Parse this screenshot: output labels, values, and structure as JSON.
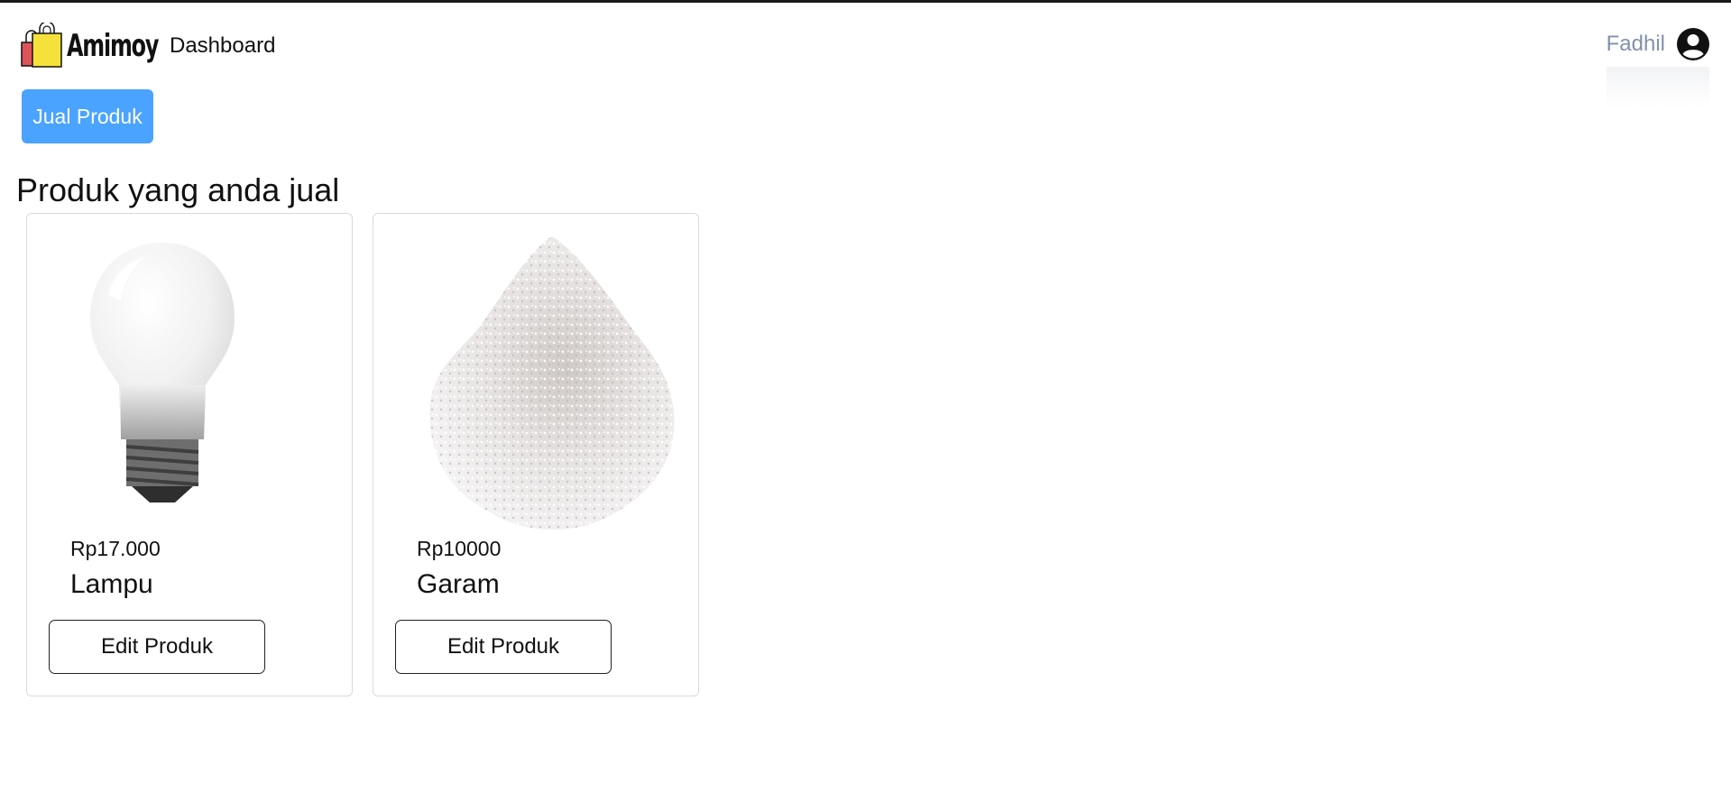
{
  "header": {
    "brand": "Amimoy",
    "nav_dashboard": "Dashboard",
    "logo_icon": "shopping-bags-icon"
  },
  "user": {
    "name": "Fadhil",
    "icon": "user-circle-icon"
  },
  "actions": {
    "sell_label": "Jual Produk"
  },
  "main": {
    "title": "Produk yang anda jual",
    "products": [
      {
        "price": "Rp17.000",
        "name": "Lampu",
        "image": "light-bulb-image",
        "edit_label": "Edit Produk"
      },
      {
        "price": "Rp10000",
        "name": "Garam",
        "image": "salt-pile-image",
        "edit_label": "Edit Produk"
      }
    ]
  },
  "colors": {
    "accent": "#4aa3ff",
    "user_name": "#8291aa",
    "card_border": "#d4dae3"
  }
}
